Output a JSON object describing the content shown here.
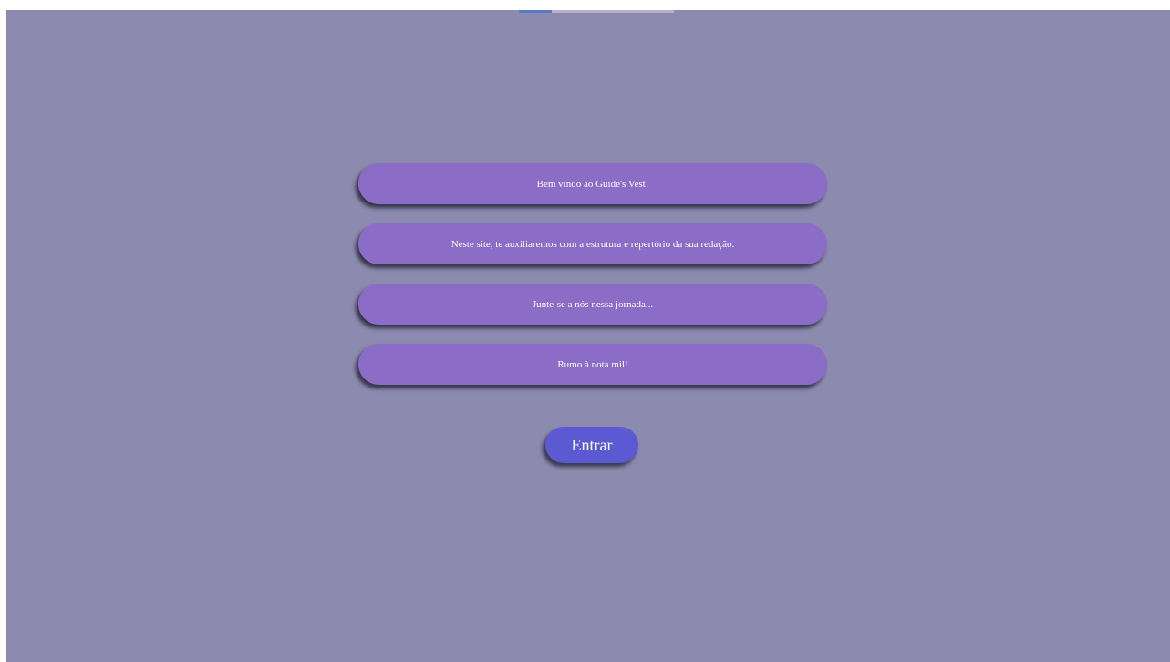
{
  "messages": {
    "welcome": "Bem vindo ao Guide's Vest!",
    "description": "Neste site, te auxiliaremos com a estrutura e repertório da sua redação.",
    "invite": "Junte-se a nós nessa jornada...",
    "goal": "Rumo à nota mil!"
  },
  "actions": {
    "enter_label": "Entrar"
  },
  "colors": {
    "background": "#8c8aae",
    "message_pill": "#8b6cc6",
    "enter_button": "#5b5ad2",
    "text": "#ffffff"
  }
}
